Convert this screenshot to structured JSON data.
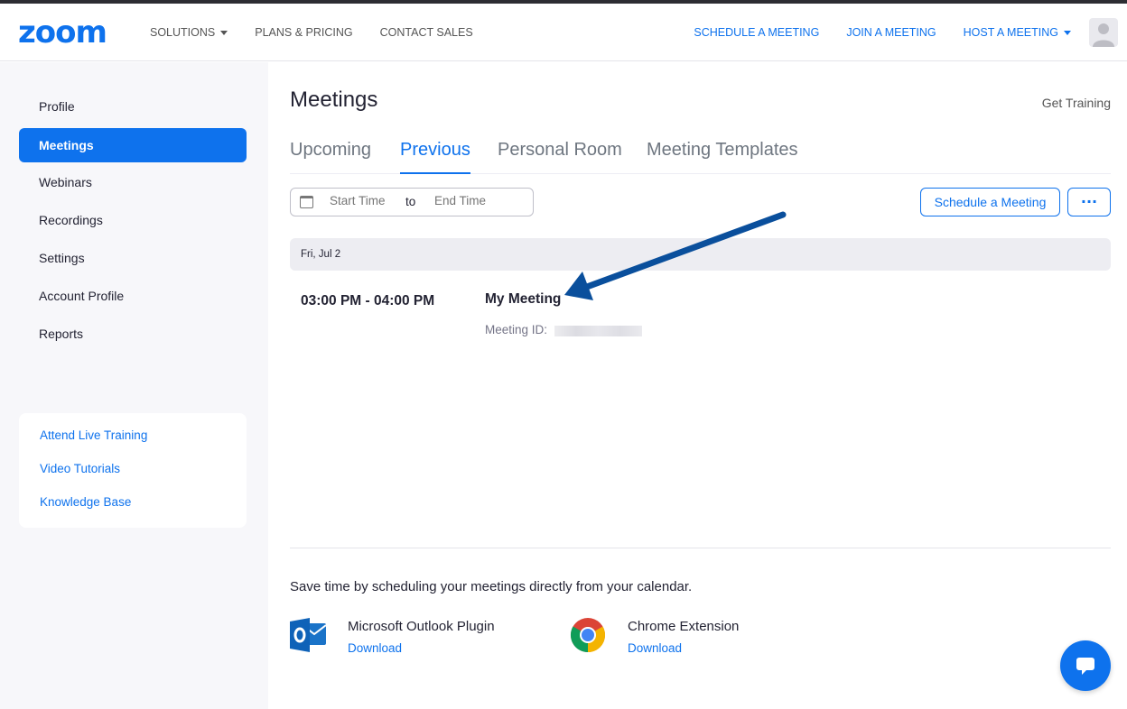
{
  "header": {
    "logo_text": "zoom",
    "nav_left": [
      {
        "label": "SOLUTIONS",
        "has_caret": true
      },
      {
        "label": "PLANS & PRICING",
        "has_caret": false
      },
      {
        "label": "CONTACT SALES",
        "has_caret": false
      }
    ],
    "nav_right": [
      {
        "label": "SCHEDULE A MEETING",
        "has_caret": false
      },
      {
        "label": "JOIN A MEETING",
        "has_caret": false
      },
      {
        "label": "HOST A MEETING",
        "has_caret": true
      }
    ],
    "avatar_icon": "user-avatar-icon"
  },
  "sidebar": {
    "items": [
      {
        "label": "Profile",
        "active": false
      },
      {
        "label": "Meetings",
        "active": true
      },
      {
        "label": "Webinars",
        "active": false
      },
      {
        "label": "Recordings",
        "active": false
      },
      {
        "label": "Settings",
        "active": false
      },
      {
        "label": "Account Profile",
        "active": false
      },
      {
        "label": "Reports",
        "active": false
      }
    ],
    "help_links": [
      {
        "label": "Attend Live Training"
      },
      {
        "label": "Video Tutorials"
      },
      {
        "label": "Knowledge Base"
      }
    ]
  },
  "main": {
    "title": "Meetings",
    "get_training": "Get Training",
    "tabs": [
      {
        "label": "Upcoming",
        "active": false
      },
      {
        "label": "Previous",
        "active": true
      },
      {
        "label": "Personal Room",
        "active": false
      },
      {
        "label": "Meeting Templates",
        "active": false
      }
    ],
    "date_filter": {
      "start_placeholder": "Start Time",
      "to_label": "to",
      "end_placeholder": "End Time"
    },
    "schedule_button": "Schedule a Meeting",
    "more_button": "···",
    "meetings_group": {
      "date_label": "Fri, Jul 2",
      "meetings": [
        {
          "time": "03:00 PM - 04:00 PM",
          "title": "My Meeting",
          "id_label": "Meeting ID:",
          "id_value_redacted": true
        }
      ]
    },
    "calendar_promo": {
      "text": "Save time by scheduling your meetings directly from your calendar.",
      "plugins": [
        {
          "name": "Microsoft Outlook Plugin",
          "link": "Download",
          "icon": "outlook-icon"
        },
        {
          "name": "Chrome Extension",
          "link": "Download",
          "icon": "chrome-icon"
        }
      ]
    }
  },
  "colors": {
    "brand_blue": "#0e72ed",
    "arrow_blue": "#0a4f9c",
    "sidebar_bg": "#f7f7fa",
    "text_dark": "#232333"
  },
  "chat_icon": "chat-bubble-icon"
}
